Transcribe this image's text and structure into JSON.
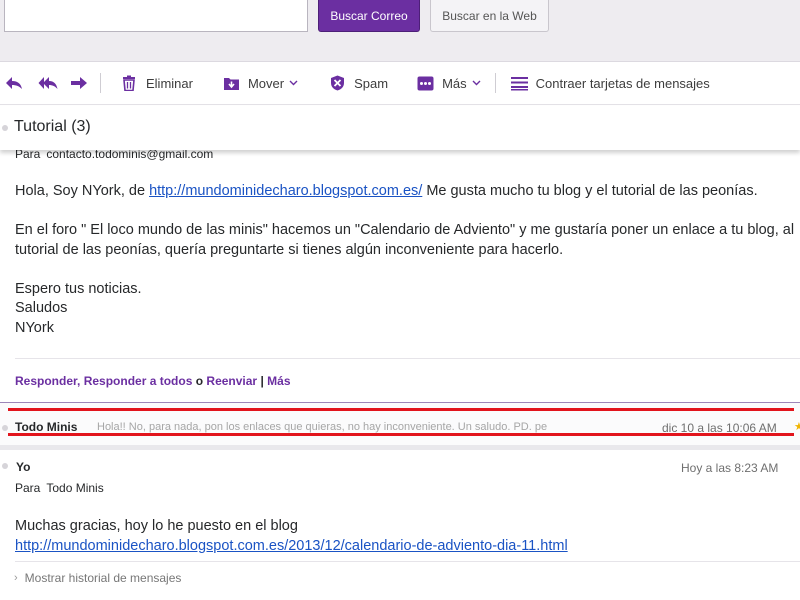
{
  "search": {
    "value": "",
    "mail_button": "Buscar Correo",
    "web_button": "Buscar en la Web"
  },
  "toolbar": {
    "delete": "Eliminar",
    "move": "Mover",
    "spam": "Spam",
    "more": "Más",
    "collapse_cards": "Contraer tarjetas de mensajes"
  },
  "subject": "Tutorial (3)",
  "message1": {
    "to_label": "Para",
    "to": "contacto.todominis@gmail.com",
    "p1_before": "Hola, Soy NYork, de ",
    "p1_link": "http://mundominidecharo.blogspot.com.es/",
    "p1_after": " Me gusta mucho tu blog y el tutorial de las peonías.",
    "p2": "En el foro \" El loco mundo de las minis\" hacemos un \"Calendario de Adviento\" y me gustaría poner un enlace a tu blog, al tutorial de las peonías, quería preguntarte si tienes algún inconveniente para hacerlo.",
    "p3_line1": "Espero tus noticias.",
    "p3_line2": "Saludos",
    "p3_line3": "NYork",
    "actions": {
      "reply": "Responder",
      "reply_all": "Responder a todos",
      "or": "o",
      "forward": "Reenviar",
      "pipe": "|",
      "more": "Más"
    }
  },
  "collapsed_message": {
    "sender": "Todo Minis",
    "snippet": "Hola!! No, para nada, pon los enlaces que quieras, no hay inconveniente. Un saludo. PD. pe",
    "date": "dic 10 a las 10:06 AM"
  },
  "message2": {
    "sender": "Yo",
    "time": "Hoy a las 8:23 AM",
    "to_label": "Para",
    "to": "Todo Minis",
    "line1": "Muchas gracias, hoy lo he puesto en el blog",
    "link": "http://mundominidecharo.blogspot.com.es/2013/12/calendario-de-adviento-dia-11.html",
    "history": "Mostrar historial de mensajes"
  },
  "colors": {
    "accent": "#6b2fa1",
    "link": "#1a53c4",
    "highlight_annotation": "#e2141c"
  },
  "icons": [
    "reply-icon",
    "reply-all-icon",
    "forward-icon",
    "trash-icon",
    "move-icon",
    "spam-shield-icon",
    "more-dots-icon",
    "chevron-down-icon",
    "collapse-list-icon",
    "star-icon",
    "chevron-right-icon"
  ]
}
